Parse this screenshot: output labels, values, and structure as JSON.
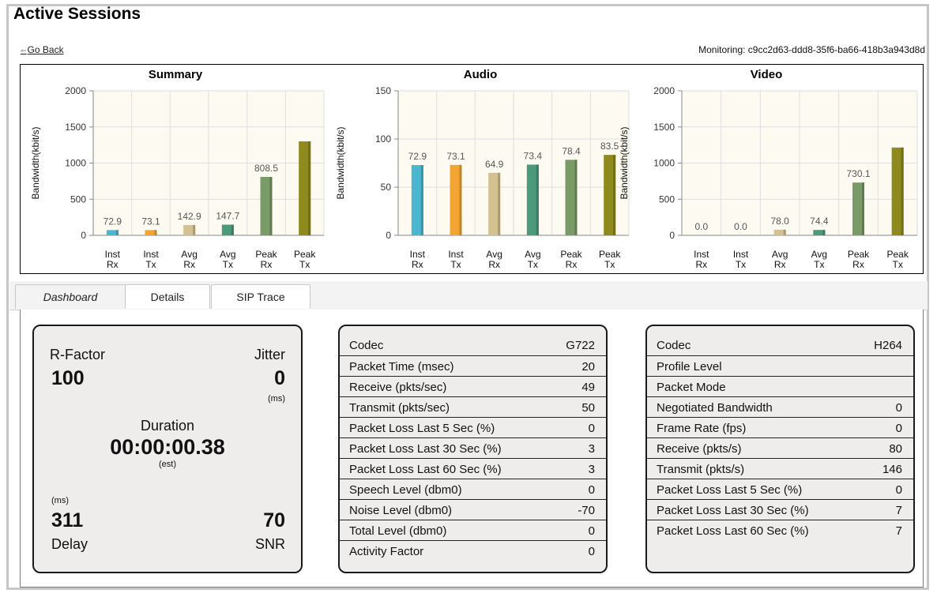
{
  "header": {
    "title": "Active Sessions",
    "go_back_label": "Go Back",
    "monitoring_text": "Monitoring: c9cc2d63-ddd8-35f6-ba66-418b3a943d8d"
  },
  "colors": {
    "inst_rx": "#4bb6cf",
    "inst_tx": "#f2a533",
    "avg_rx": "#d4c190",
    "avg_tx": "#4b9a7c",
    "peak_rx": "#7a9a68",
    "peak_tx": "#8e8a1e",
    "plot_bg": "#fdfbf1",
    "panel_bg": "#efecec"
  },
  "chart_data": [
    {
      "type": "bar",
      "title": "Summary",
      "ylabel": "Bandwidth(kbit/s)",
      "categories": [
        [
          "Inst",
          "Rx"
        ],
        [
          "Inst",
          "Tx"
        ],
        [
          "Avg",
          "Rx"
        ],
        [
          "Avg",
          "Tx"
        ],
        [
          "Peak",
          "Rx"
        ],
        [
          "Peak",
          "Tx"
        ]
      ],
      "values": [
        72.9,
        73.1,
        142.9,
        147.7,
        808.5,
        1300
      ],
      "labels": [
        "72.9",
        "73.1",
        "142.9",
        "147.7",
        "808.5",
        ""
      ],
      "ylim": [
        0,
        2000
      ],
      "yticks": [
        0,
        500,
        1000,
        1500,
        2000
      ]
    },
    {
      "type": "bar",
      "title": "Audio",
      "ylabel": "Bandwidth(kbit/s)",
      "categories": [
        [
          "Inst",
          "Rx"
        ],
        [
          "Inst",
          "Tx"
        ],
        [
          "Avg",
          "Rx"
        ],
        [
          "Avg",
          "Tx"
        ],
        [
          "Peak",
          "Rx"
        ],
        [
          "Peak",
          "Tx"
        ]
      ],
      "values": [
        72.9,
        73.1,
        64.9,
        73.4,
        78.4,
        83.5
      ],
      "labels": [
        "72.9",
        "73.1",
        "64.9",
        "73.4",
        "78.4",
        "83.5"
      ],
      "ylim": [
        0,
        150
      ],
      "yticks": [
        0,
        50,
        100,
        150
      ]
    },
    {
      "type": "bar",
      "title": "Video",
      "ylabel": "Bandwidth(kbit/s)",
      "categories": [
        [
          "Inst",
          "Rx"
        ],
        [
          "Inst",
          "Tx"
        ],
        [
          "Avg",
          "Rx"
        ],
        [
          "Avg",
          "Tx"
        ],
        [
          "Peak",
          "Rx"
        ],
        [
          "Peak",
          "Tx"
        ]
      ],
      "values": [
        0.0,
        0.0,
        78.0,
        74.4,
        730.1,
        1215
      ],
      "labels": [
        "0.0",
        "0.0",
        "78.0",
        "74.4",
        "730.1",
        ""
      ],
      "ylim": [
        0,
        2000
      ],
      "yticks": [
        0,
        500,
        1000,
        1500,
        2000
      ]
    }
  ],
  "tabs": [
    {
      "label": "Dashboard",
      "active": true
    },
    {
      "label": "Details",
      "active": false
    },
    {
      "label": "SIP Trace",
      "active": false
    }
  ],
  "quality": {
    "rfactor_label": "R-Factor",
    "rfactor_value": "100",
    "jitter_label": "Jitter",
    "jitter_value": "0",
    "jitter_unit": "(ms)",
    "duration_label": "Duration",
    "duration_value": "00:00:00.38",
    "duration_note": "(est)",
    "delay_unit": "(ms)",
    "delay_value": "311",
    "delay_label": "Delay",
    "snr_value": "70",
    "snr_label": "SNR"
  },
  "audio_stats": [
    {
      "k": "Codec",
      "v": "G722"
    },
    {
      "k": "Packet Time (msec)",
      "v": "20"
    },
    {
      "k": "Receive (pkts/sec)",
      "v": "49"
    },
    {
      "k": "Transmit (pkts/sec)",
      "v": "50"
    },
    {
      "k": "Packet Loss Last 5 Sec (%)",
      "v": "0"
    },
    {
      "k": "Packet Loss Last 30 Sec (%)",
      "v": "3"
    },
    {
      "k": "Packet Loss Last 60 Sec (%)",
      "v": "3"
    },
    {
      "k": "Speech Level (dbm0)",
      "v": "0"
    },
    {
      "k": "Noise Level (dbm0)",
      "v": "-70"
    },
    {
      "k": "Total Level (dbm0)",
      "v": "0"
    },
    {
      "k": "Activity Factor",
      "v": "0"
    }
  ],
  "video_stats": [
    {
      "k": "Codec",
      "v": "H264"
    },
    {
      "k": "Profile Level",
      "v": ""
    },
    {
      "k": "Packet Mode",
      "v": ""
    },
    {
      "k": "Negotiated Bandwidth",
      "v": "0"
    },
    {
      "k": "Frame Rate (fps)",
      "v": "0"
    },
    {
      "k": "Receive (pkts/s)",
      "v": "80"
    },
    {
      "k": "Transmit (pkts/s)",
      "v": "146"
    },
    {
      "k": "Packet Loss Last 5 Sec (%)",
      "v": "0"
    },
    {
      "k": "Packet Loss Last 30 Sec (%)",
      "v": "7"
    },
    {
      "k": "Packet Loss Last 60 Sec (%)",
      "v": "7"
    }
  ]
}
